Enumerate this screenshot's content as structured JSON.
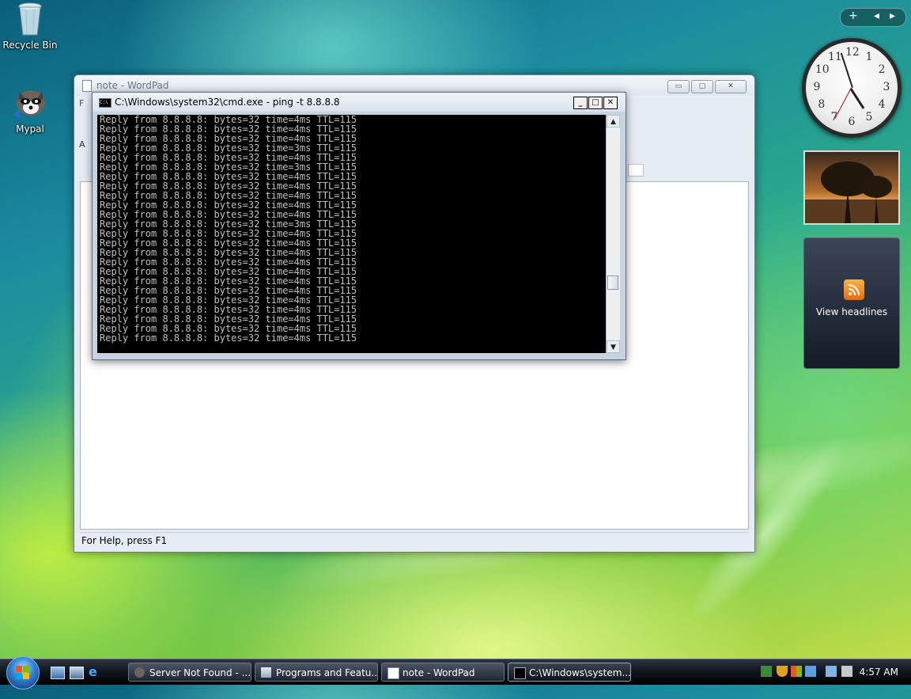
{
  "desktop": {
    "icons": [
      {
        "label": "Recycle Bin"
      },
      {
        "label": "Mypal"
      }
    ]
  },
  "wordpad": {
    "title": "note - WordPad",
    "status": "For Help, press F1",
    "menu_hint": "F",
    "toolbar_hint": "A",
    "minimize": "▭",
    "maximize": "▢",
    "close": "✕"
  },
  "cmd": {
    "title": "C:\\Windows\\system32\\cmd.exe - ping  -t 8.8.8.8",
    "icon_text": "C:\\",
    "lines": [
      "Reply from 8.8.8.8: bytes=32 time=4ms TTL=115",
      "Reply from 8.8.8.8: bytes=32 time=4ms TTL=115",
      "Reply from 8.8.8.8: bytes=32 time=4ms TTL=115",
      "Reply from 8.8.8.8: bytes=32 time=3ms TTL=115",
      "Reply from 8.8.8.8: bytes=32 time=4ms TTL=115",
      "Reply from 8.8.8.8: bytes=32 time=3ms TTL=115",
      "Reply from 8.8.8.8: bytes=32 time=4ms TTL=115",
      "Reply from 8.8.8.8: bytes=32 time=4ms TTL=115",
      "Reply from 8.8.8.8: bytes=32 time=4ms TTL=115",
      "Reply from 8.8.8.8: bytes=32 time=4ms TTL=115",
      "Reply from 8.8.8.8: bytes=32 time=4ms TTL=115",
      "Reply from 8.8.8.8: bytes=32 time=3ms TTL=115",
      "Reply from 8.8.8.8: bytes=32 time=4ms TTL=115",
      "Reply from 8.8.8.8: bytes=32 time=4ms TTL=115",
      "Reply from 8.8.8.8: bytes=32 time=4ms TTL=115",
      "Reply from 8.8.8.8: bytes=32 time=4ms TTL=115",
      "Reply from 8.8.8.8: bytes=32 time=4ms TTL=115",
      "Reply from 8.8.8.8: bytes=32 time=4ms TTL=115",
      "Reply from 8.8.8.8: bytes=32 time=4ms TTL=115",
      "Reply from 8.8.8.8: bytes=32 time=4ms TTL=115",
      "Reply from 8.8.8.8: bytes=32 time=4ms TTL=115",
      "Reply from 8.8.8.8: bytes=32 time=4ms TTL=115",
      "Reply from 8.8.8.8: bytes=32 time=4ms TTL=115",
      "Reply from 8.8.8.8: bytes=32 time=4ms TTL=115"
    ],
    "minimize": "_",
    "maximize": "□",
    "close": "✕",
    "scroll_up": "▲",
    "scroll_down": "▼"
  },
  "gadgets": {
    "bar_add": "+",
    "bar_prev": "◂",
    "bar_next": "▸",
    "clock_numbers": [
      "12",
      "1",
      "2",
      "3",
      "4",
      "5",
      "6",
      "7",
      "8",
      "9",
      "10",
      "11"
    ],
    "feed_label": "View headlines",
    "feed_icon": "rss-icon"
  },
  "taskbar": {
    "tasks": [
      {
        "label": "Server Not Found - ..."
      },
      {
        "label": "Programs and Featu..."
      },
      {
        "label": "note - WordPad"
      },
      {
        "label": "C:\\Windows\\system..."
      }
    ],
    "clock": "4:57 AM"
  }
}
